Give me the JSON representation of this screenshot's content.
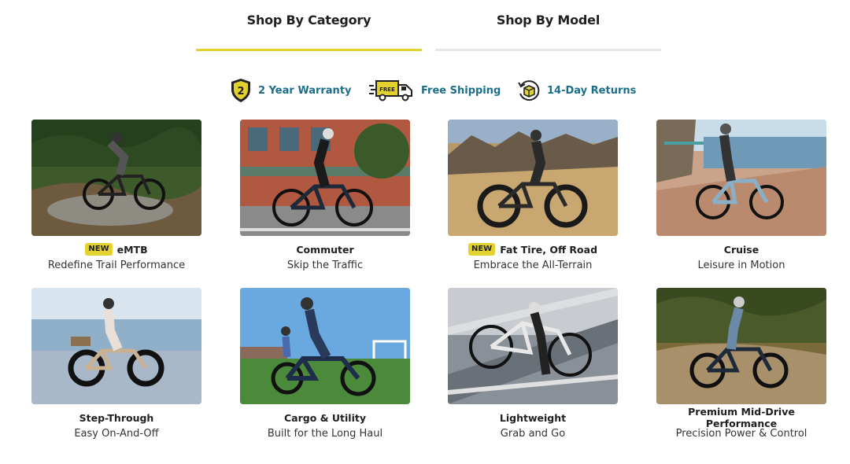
{
  "tabs": [
    {
      "label": "Shop By Category",
      "active": true
    },
    {
      "label": "Shop By Model",
      "active": false
    }
  ],
  "perks": [
    {
      "icon": "warranty-shield-icon",
      "label": "2 Year Warranty",
      "icon_text": "2"
    },
    {
      "icon": "free-shipping-truck-icon",
      "label": "Free Shipping",
      "icon_text": "FREE"
    },
    {
      "icon": "returns-box-icon",
      "label": "14-Day Returns"
    }
  ],
  "categories": [
    {
      "badge": "NEW",
      "title": "eMTB",
      "subtitle": "Redefine Trail Performance"
    },
    {
      "badge": "",
      "title": "Commuter",
      "subtitle": "Skip the Traffic"
    },
    {
      "badge": "NEW",
      "title": "Fat Tire, Off Road",
      "subtitle": "Embrace the All-Terrain"
    },
    {
      "badge": "",
      "title": "Cruise",
      "subtitle": "Leisure in Motion"
    },
    {
      "badge": "",
      "title": "Step-Through",
      "subtitle": "Easy On-And-Off"
    },
    {
      "badge": "",
      "title": "Cargo & Utility",
      "subtitle": "Built for the Long Haul"
    },
    {
      "badge": "",
      "title": "Lightweight",
      "subtitle": "Grab and Go"
    },
    {
      "badge": "",
      "title": "Premium Mid-Drive Performance",
      "subtitle": "Precision Power & Control"
    }
  ],
  "colors": {
    "accent": "#e3d22e",
    "perk_text": "#1b6e8a",
    "inactive_tab_line": "#e6e6e6"
  }
}
